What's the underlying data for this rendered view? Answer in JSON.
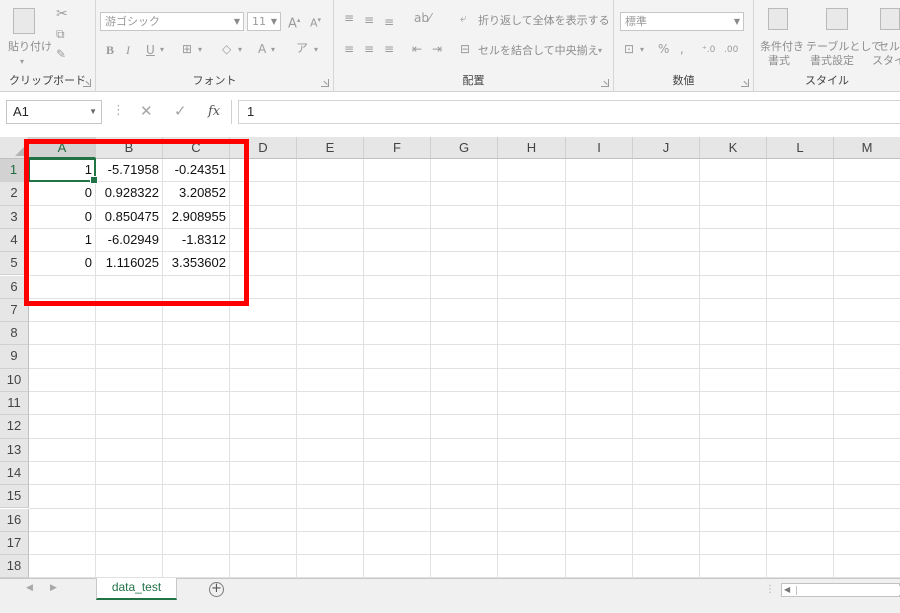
{
  "ribbon": {
    "clipboard": {
      "label": "クリップボード",
      "paste_label": "貼り付け"
    },
    "font": {
      "label": "フォント",
      "font_name": "游ゴシック",
      "font_size": "11",
      "bold": "B",
      "italic": "I",
      "underline": "U"
    },
    "alignment": {
      "label": "配置",
      "wrap_text": "折り返して全体を表示する",
      "merge_center": "セルを結合して中央揃え"
    },
    "number": {
      "label": "数値",
      "format": "標準",
      "percent": "%",
      "comma": ","
    },
    "styles": {
      "label": "スタイル",
      "conditional_1": "条件付き",
      "conditional_2": "書式",
      "table_1": "テーブルとして",
      "table_2": "書式設定",
      "cell_1": "セル",
      "cell_2": "スタイ"
    }
  },
  "formula_bar": {
    "name_box": "A1",
    "formula": "1",
    "fx": "fx",
    "cancel": "✕",
    "enter": "✓"
  },
  "columns": [
    "A",
    "B",
    "C",
    "D",
    "E",
    "F",
    "G",
    "H",
    "I",
    "J",
    "K",
    "L",
    "M"
  ],
  "rows": [
    "1",
    "2",
    "3",
    "4",
    "5",
    "6",
    "7",
    "8",
    "9",
    "10",
    "11",
    "12",
    "13",
    "14",
    "15",
    "16",
    "17",
    "18"
  ],
  "cells": [
    [
      "1",
      "-5.71958",
      "-0.24351"
    ],
    [
      "0",
      "0.928322",
      "3.20852"
    ],
    [
      "0",
      "0.850475",
      "2.908955"
    ],
    [
      "1",
      "-6.02949",
      "-1.8312"
    ],
    [
      "0",
      "1.116025",
      "3.353602"
    ]
  ],
  "sheet_tab": {
    "name": "data_test",
    "add": "+"
  },
  "colors": {
    "accent": "#217346",
    "highlight": "#ff0000"
  }
}
